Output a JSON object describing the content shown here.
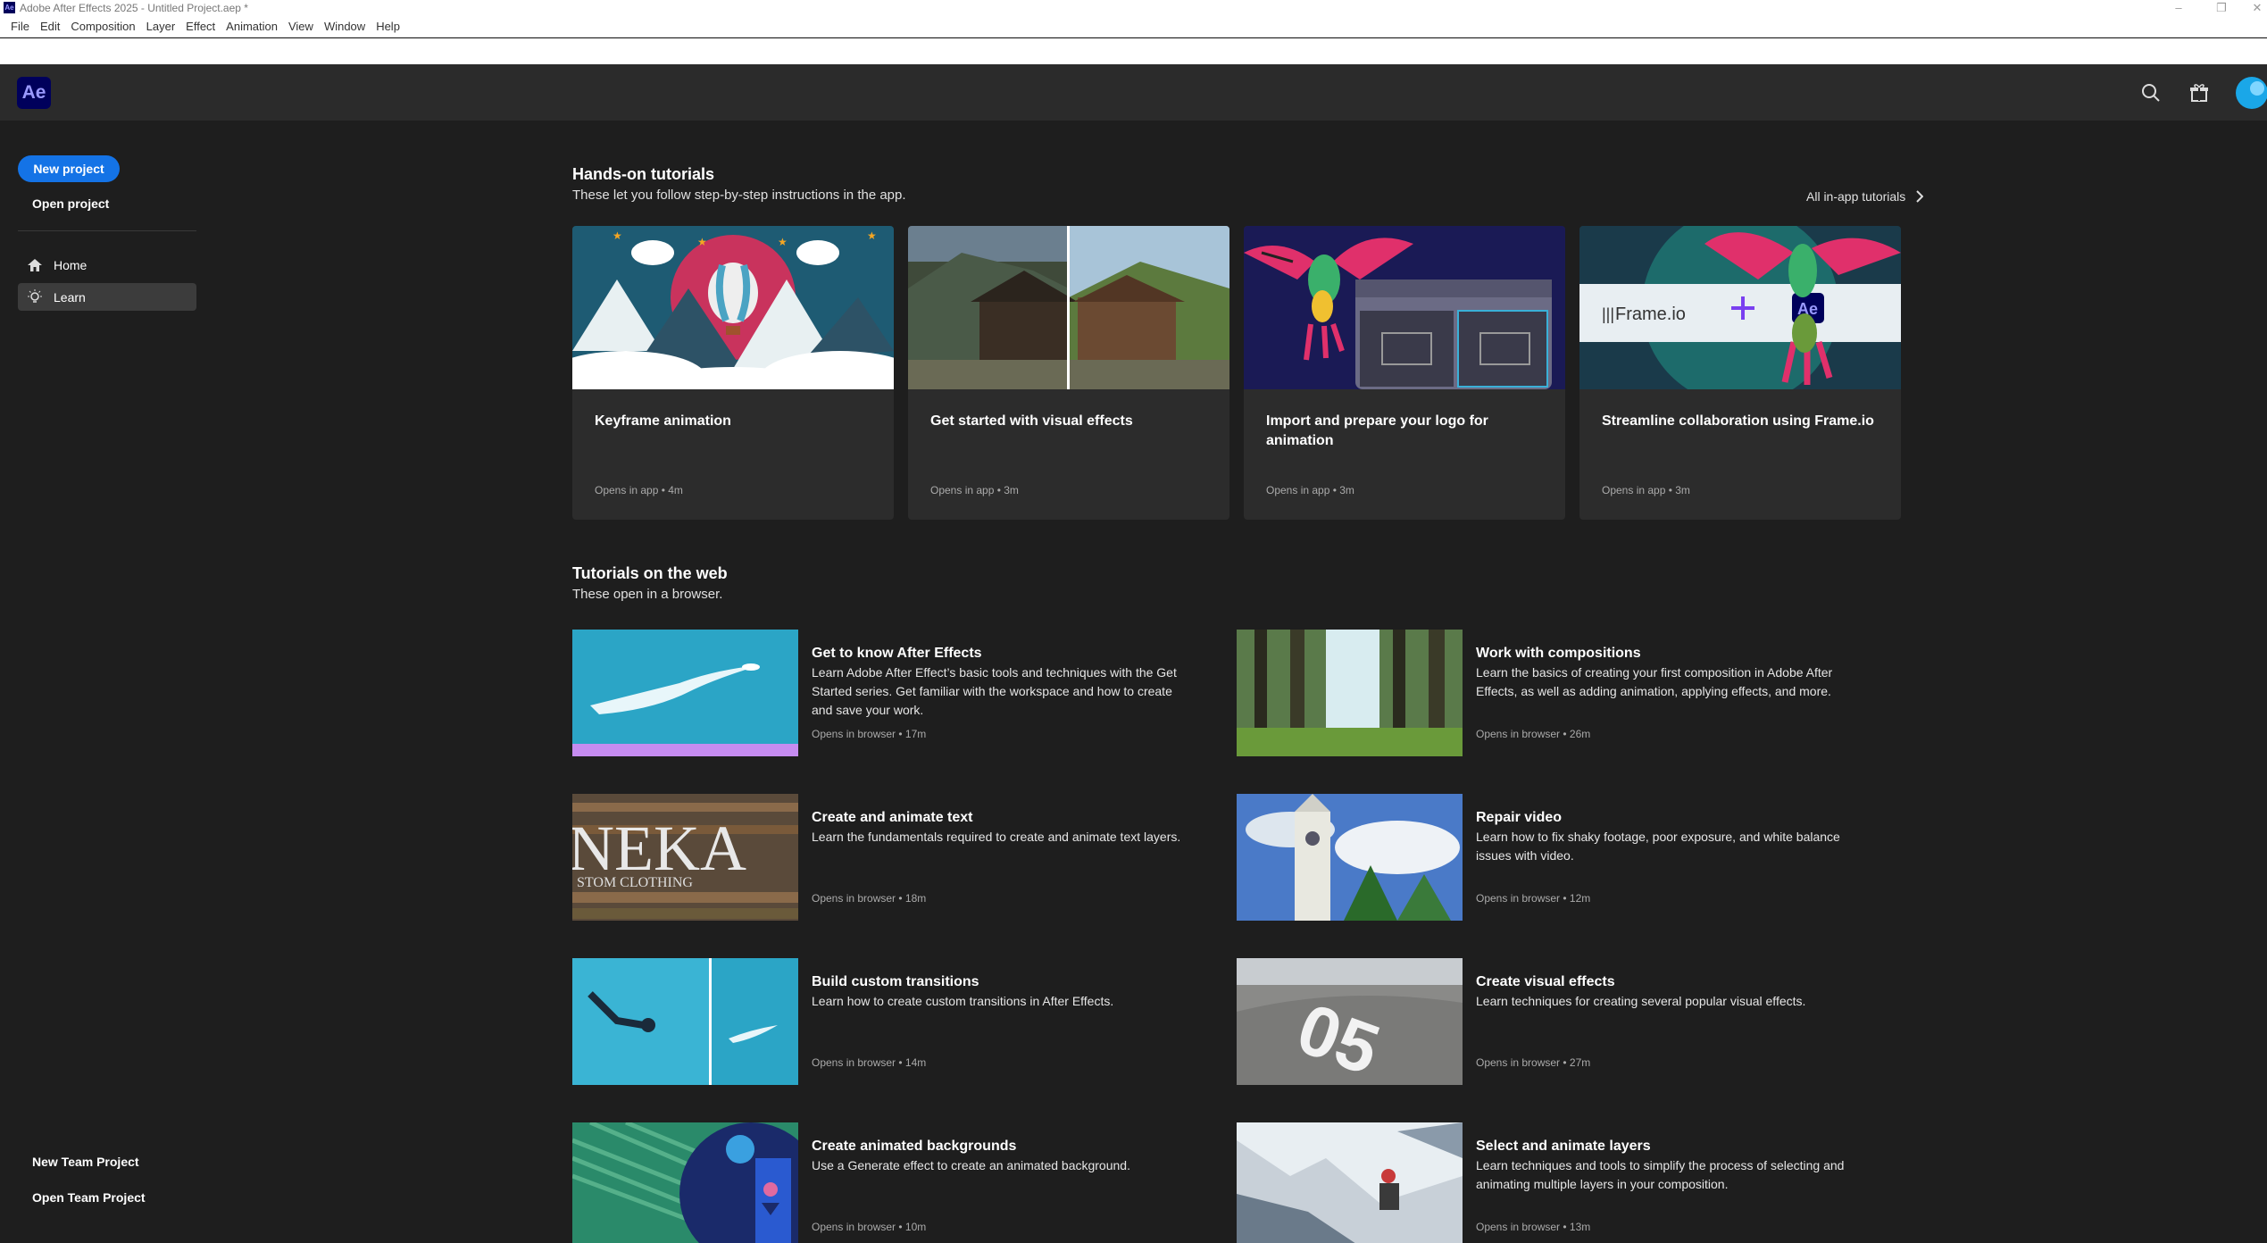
{
  "titlebar": {
    "title": "Adobe After Effects 2025 - Untitled Project.aep *",
    "app_icon": "Ae"
  },
  "menu": [
    "File",
    "Edit",
    "Composition",
    "Layer",
    "Effect",
    "Animation",
    "View",
    "Window",
    "Help"
  ],
  "header": {
    "logo": "Ae",
    "icons": [
      "search-icon",
      "gift-icon",
      "profile-icon"
    ]
  },
  "sidebar": {
    "new_project": "New project",
    "open_project": "Open project",
    "nav": [
      {
        "label": "Home",
        "icon": "home-icon",
        "active": false
      },
      {
        "label": "Learn",
        "icon": "lightbulb-icon",
        "active": true
      }
    ],
    "new_team_project": "New Team Project",
    "open_team_project": "Open Team Project"
  },
  "hands_on": {
    "title": "Hands-on tutorials",
    "subtitle": "These let you follow step-by-step instructions in the app.",
    "all_link": "All in-app tutorials",
    "cards": [
      {
        "title": "Keyframe animation",
        "meta": "Opens in app • 4m"
      },
      {
        "title": "Get started with visual effects",
        "meta": "Opens in app • 3m"
      },
      {
        "title": "Import and prepare your logo for animation",
        "meta": "Opens in app • 3m"
      },
      {
        "title": "Streamline collaboration using Frame.io",
        "meta": "Opens in app • 3m",
        "thumb_text": "Frame.io",
        "thumb_badge": "Ae"
      }
    ]
  },
  "web": {
    "title": "Tutorials on the web",
    "subtitle": "These open in a browser.",
    "items": [
      {
        "title": "Get to know After Effects",
        "desc": "Learn Adobe After Effect’s basic tools and techniques with the Get Started series. Get familiar with the workspace and how to create and save your work.",
        "meta": "Opens in browser • 17m"
      },
      {
        "title": "Work with compositions",
        "desc": "Learn the basics of creating your first composition in Adobe After Effects, as well as adding animation, applying effects, and more.",
        "meta": "Opens in browser • 26m"
      },
      {
        "title": "Create and animate text",
        "desc": "Learn the fundamentals required to create and animate text layers.",
        "meta": "Opens in browser • 18m",
        "thumb_text": "NEKA",
        "thumb_sub": "STOM CLOTHING"
      },
      {
        "title": "Repair video",
        "desc": "Learn how to fix shaky footage, poor exposure, and white balance issues with video.",
        "meta": "Opens in browser • 12m"
      },
      {
        "title": "Build custom transitions",
        "desc": "Learn how to create custom transitions in After Effects.",
        "meta": "Opens in browser • 14m"
      },
      {
        "title": "Create visual effects",
        "desc": "Learn techniques for creating several popular visual effects.",
        "meta": "Opens in browser • 27m",
        "thumb_text": "05"
      },
      {
        "title": "Create animated backgrounds",
        "desc": "Use a Generate effect to create an animated background.",
        "meta": "Opens in browser • 10m"
      },
      {
        "title": "Select and animate layers",
        "desc": "Learn techniques and tools to simplify the process of selecting and animating multiple layers in your composition.",
        "meta": "Opens in browser • 13m"
      }
    ]
  },
  "colors": {
    "accent": "#1473e6",
    "ae_brand": "#00005b",
    "ae_text": "#9999ff",
    "bg": "#1e1e1e",
    "card": "#2c2c2c"
  }
}
